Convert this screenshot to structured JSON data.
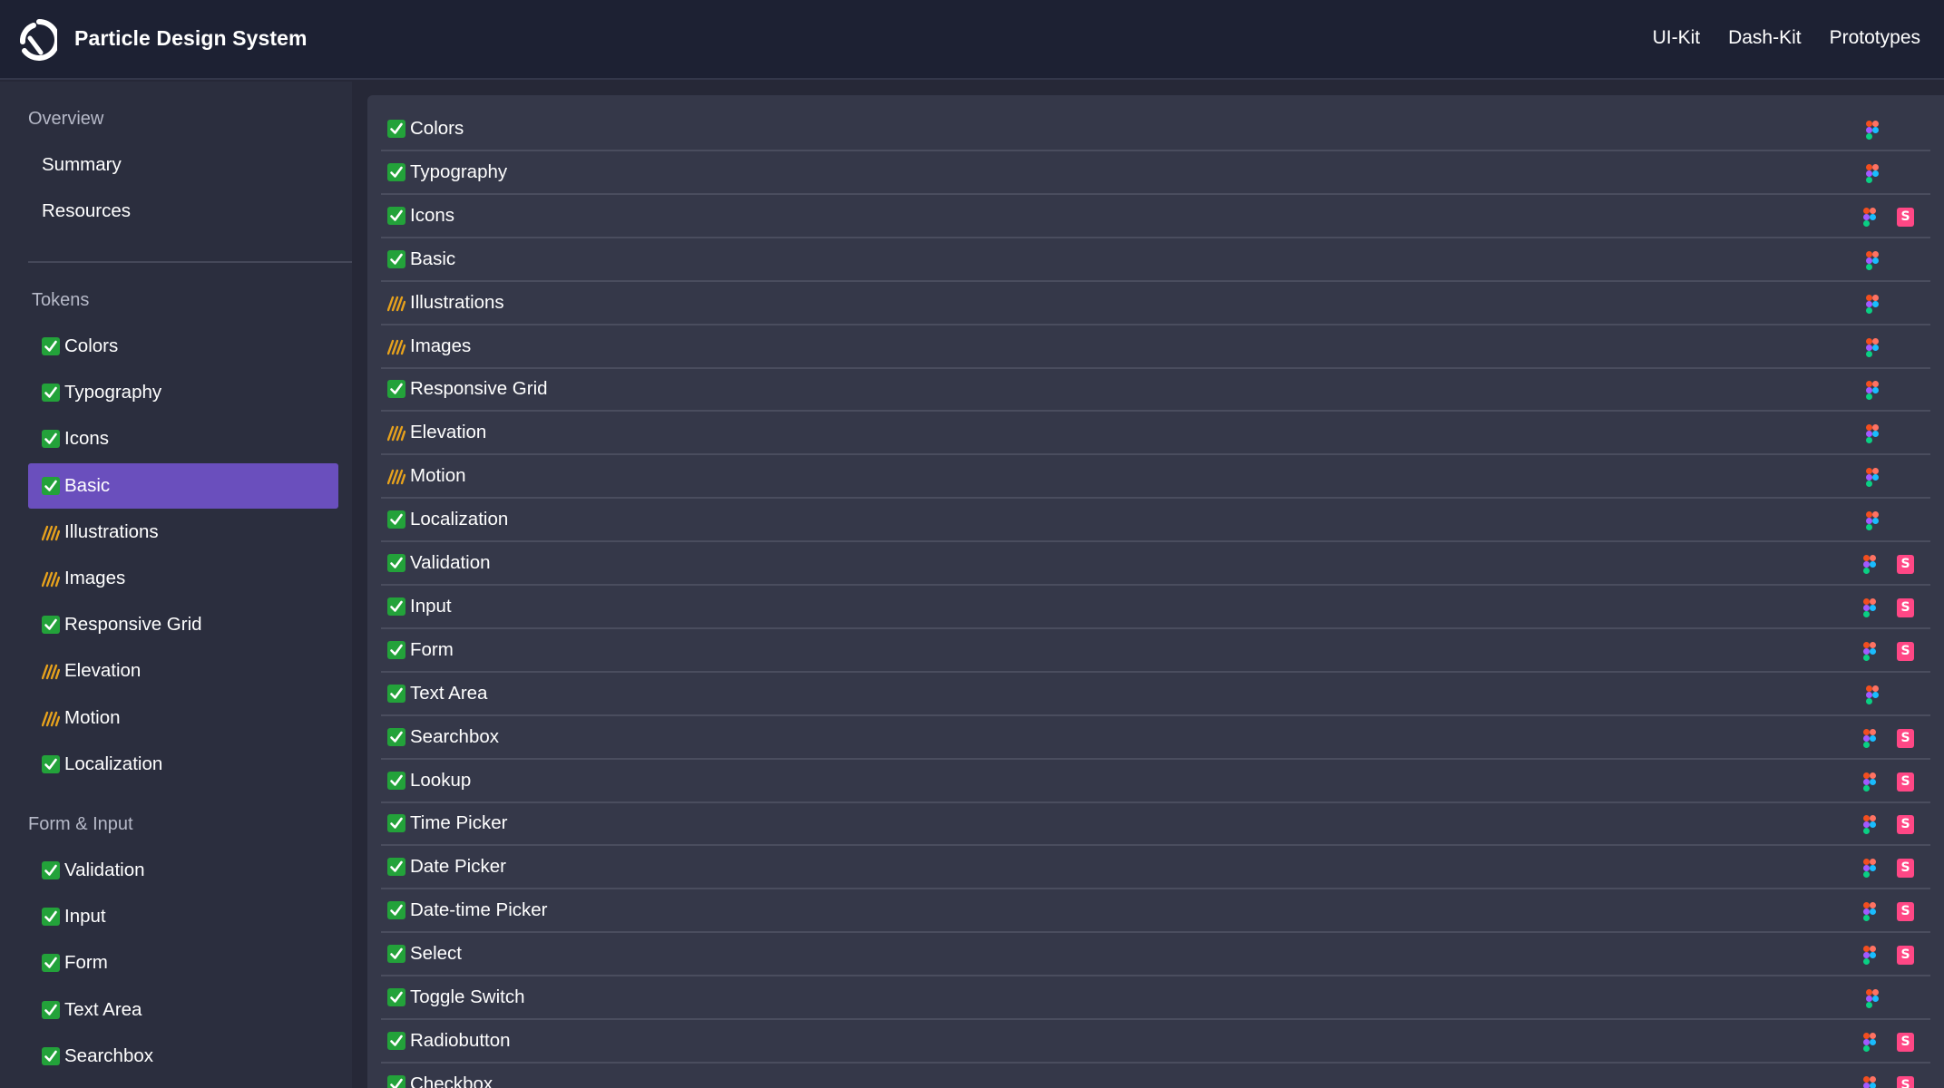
{
  "header": {
    "title": "Particle Design System",
    "nav": [
      "UI-Kit",
      "Dash-Kit",
      "Prototypes"
    ]
  },
  "colors": {
    "topbar": "#1d2133",
    "sidebar": "#2b2e3e",
    "panel": "#353849",
    "active": "#6a4fbd",
    "done": "#23a23a",
    "storybook": "#ff4785"
  },
  "sidebar": {
    "overview": {
      "title": "Overview",
      "links": [
        "Summary",
        "Resources"
      ]
    },
    "tokens": {
      "title": "Tokens",
      "items": [
        {
          "label": "Colors",
          "status": "done"
        },
        {
          "label": "Typography",
          "status": "done"
        },
        {
          "label": "Icons",
          "status": "done"
        },
        {
          "label": "Basic",
          "status": "done",
          "active": true
        },
        {
          "label": "Illustrations",
          "status": "wip"
        },
        {
          "label": "Images",
          "status": "wip"
        },
        {
          "label": "Responsive Grid",
          "status": "done"
        },
        {
          "label": "Elevation",
          "status": "wip"
        },
        {
          "label": "Motion",
          "status": "wip"
        },
        {
          "label": "Localization",
          "status": "done"
        }
      ]
    },
    "form_input": {
      "title": "Form & Input",
      "items": [
        {
          "label": "Validation",
          "status": "done"
        },
        {
          "label": "Input",
          "status": "done"
        },
        {
          "label": "Form",
          "status": "done"
        },
        {
          "label": "Text Area",
          "status": "done"
        },
        {
          "label": "Searchbox",
          "status": "done"
        }
      ]
    }
  },
  "main": {
    "rows": [
      {
        "label": "Colors",
        "status": "done",
        "storybook": false
      },
      {
        "label": "Typography",
        "status": "done",
        "storybook": false
      },
      {
        "label": "Icons",
        "status": "done",
        "storybook": true
      },
      {
        "label": "Basic",
        "status": "done",
        "storybook": false
      },
      {
        "label": "Illustrations",
        "status": "wip",
        "storybook": false
      },
      {
        "label": "Images",
        "status": "wip",
        "storybook": false
      },
      {
        "label": "Responsive Grid",
        "status": "done",
        "storybook": false
      },
      {
        "label": "Elevation",
        "status": "wip",
        "storybook": false
      },
      {
        "label": "Motion",
        "status": "wip",
        "storybook": false
      },
      {
        "label": "Localization",
        "status": "done",
        "storybook": false
      },
      {
        "label": "Validation",
        "status": "done",
        "storybook": true
      },
      {
        "label": "Input",
        "status": "done",
        "storybook": true
      },
      {
        "label": "Form",
        "status": "done",
        "storybook": true
      },
      {
        "label": "Text Area",
        "status": "done",
        "storybook": false
      },
      {
        "label": "Searchbox",
        "status": "done",
        "storybook": true
      },
      {
        "label": "Lookup",
        "status": "done",
        "storybook": true
      },
      {
        "label": "Time Picker",
        "status": "done",
        "storybook": true
      },
      {
        "label": "Date Picker",
        "status": "done",
        "storybook": true
      },
      {
        "label": "Date-time Picker",
        "status": "done",
        "storybook": true
      },
      {
        "label": "Select",
        "status": "done",
        "storybook": true
      },
      {
        "label": "Toggle Switch",
        "status": "done",
        "storybook": false
      },
      {
        "label": "Radiobutton",
        "status": "done",
        "storybook": true
      },
      {
        "label": "Checkbox",
        "status": "done",
        "storybook": true
      }
    ]
  }
}
